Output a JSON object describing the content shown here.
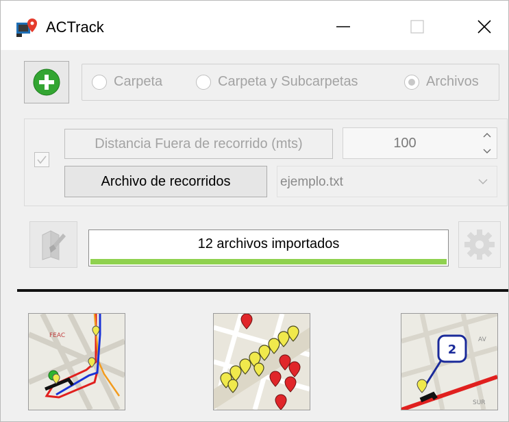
{
  "window": {
    "title": "ACTrack"
  },
  "source_options": [
    {
      "label": "Carpeta",
      "checked": false
    },
    {
      "label": "Carpeta y Subcarpetas",
      "checked": false
    },
    {
      "label": "Archivos",
      "checked": true
    }
  ],
  "distance": {
    "button_label": "Distancia Fuera de recorrido (mts)",
    "value": "100",
    "enabled_checked": true
  },
  "routes_file": {
    "button_label": "Archivo de recorridos",
    "selected": "ejemplo.txt"
  },
  "progress": {
    "text": "12 archivos importados",
    "fraction": 1.0
  },
  "tool_buttons": {
    "route_view": "route-map-icon",
    "points_view": "pins-map-icon",
    "stops_view": "stop-count-map-icon",
    "stops_badge": "2"
  },
  "colors": {
    "accent_green": "#33a532",
    "progress_green": "#8fd14f",
    "route_red": "#e0201e",
    "route_blue": "#1a33d6",
    "pin_yellow": "#f0e94c"
  }
}
